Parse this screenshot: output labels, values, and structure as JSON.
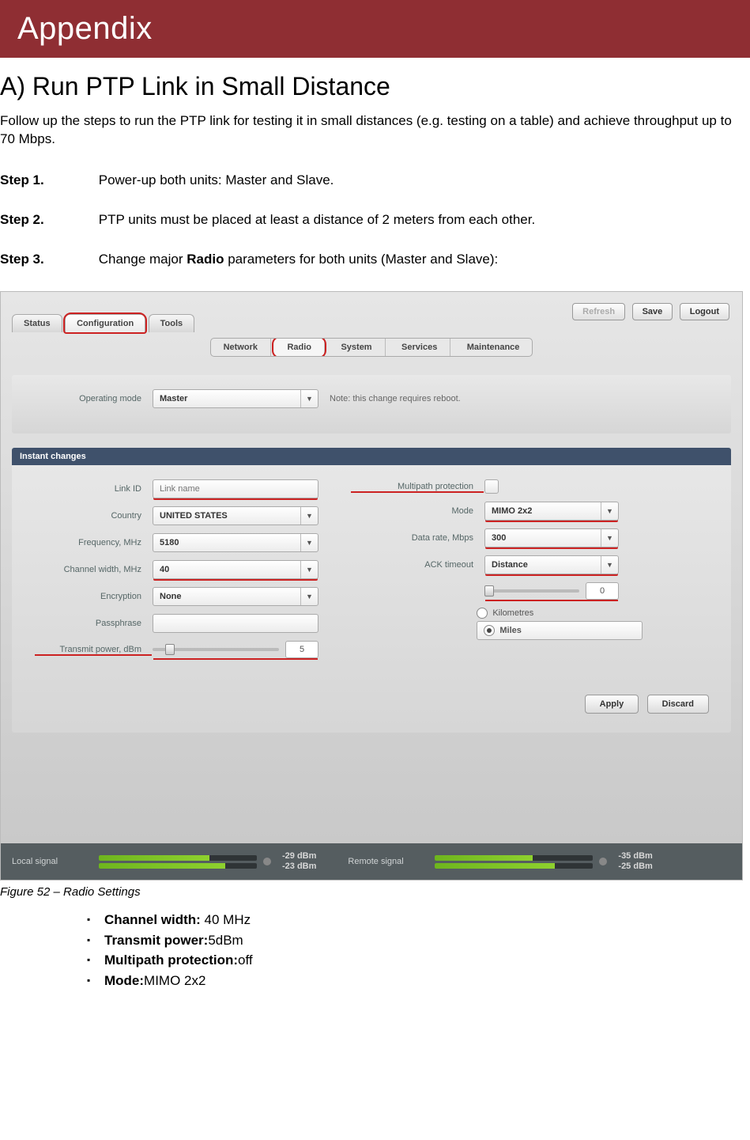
{
  "banner": {
    "title": "Appendix"
  },
  "heading": "A) Run PTP Link in Small Distance",
  "intro": "Follow up the steps to run the PTP link for testing it in small distances (e.g. testing on a table) and achieve throughput up to 70 Mbps.",
  "steps": {
    "s1": {
      "label": "Step 1.",
      "text": "Power-up both units: Master and Slave."
    },
    "s2": {
      "label": "Step 2.",
      "text": "PTP units must be placed at least a distance of 2 meters from each other."
    },
    "s3": {
      "label": "Step 3.",
      "text_prefix": "Change major ",
      "bold": "Radio",
      "text_suffix": " parameters for both units (Master and Slave):"
    }
  },
  "ui": {
    "top_buttons": {
      "refresh": "Refresh",
      "save": "Save",
      "logout": "Logout"
    },
    "main_tabs": {
      "status": "Status",
      "configuration": "Configuration",
      "tools": "Tools"
    },
    "sub_tabs": {
      "network": "Network",
      "radio": "Radio",
      "system": "System",
      "services": "Services",
      "maintenance": "Maintenance"
    },
    "op_mode": {
      "label": "Operating mode",
      "value": "Master",
      "note": "Note: this change requires reboot."
    },
    "section_instant": "Instant changes",
    "left": {
      "link_id": {
        "label": "Link ID",
        "placeholder": "Link name"
      },
      "country": {
        "label": "Country",
        "value": "UNITED STATES"
      },
      "frequency": {
        "label": "Frequency, MHz",
        "value": "5180"
      },
      "chanwidth": {
        "label": "Channel width, MHz",
        "value": "40"
      },
      "encryption": {
        "label": "Encryption",
        "value": "None"
      },
      "passphrase": {
        "label": "Passphrase",
        "value": ""
      },
      "txpower": {
        "label": "Transmit power, dBm",
        "value": "5"
      }
    },
    "right": {
      "multipath": {
        "label": "Multipath protection"
      },
      "mode": {
        "label": "Mode",
        "value": "MIMO 2x2"
      },
      "datarate": {
        "label": "Data rate, Mbps",
        "value": "300"
      },
      "ack": {
        "label": "ACK timeout",
        "value": "Distance"
      },
      "distance": {
        "value": "0"
      },
      "units": {
        "km": "Kilometres",
        "mi": "Miles"
      }
    },
    "actions": {
      "apply": "Apply",
      "discard": "Discard"
    },
    "signal": {
      "local_label": "Local signal",
      "local": {
        "a": "-29 dBm",
        "b": "-23 dBm",
        "fill_a": 70,
        "fill_b": 80
      },
      "remote_label": "Remote signal",
      "remote": {
        "a": "-35 dBm",
        "b": "-25 dBm",
        "fill_a": 62,
        "fill_b": 76
      }
    }
  },
  "caption": "Figure 52 – Radio Settings",
  "bullets": {
    "b1": {
      "k": "Channel width: ",
      "v": "40 MHz"
    },
    "b2": {
      "k": "Transmit power:",
      "v": "5dBm"
    },
    "b3": {
      "k": "Multipath protection:",
      "v": "off"
    },
    "b4": {
      "k": "Mode:",
      "v": "MIMO 2x2"
    }
  }
}
